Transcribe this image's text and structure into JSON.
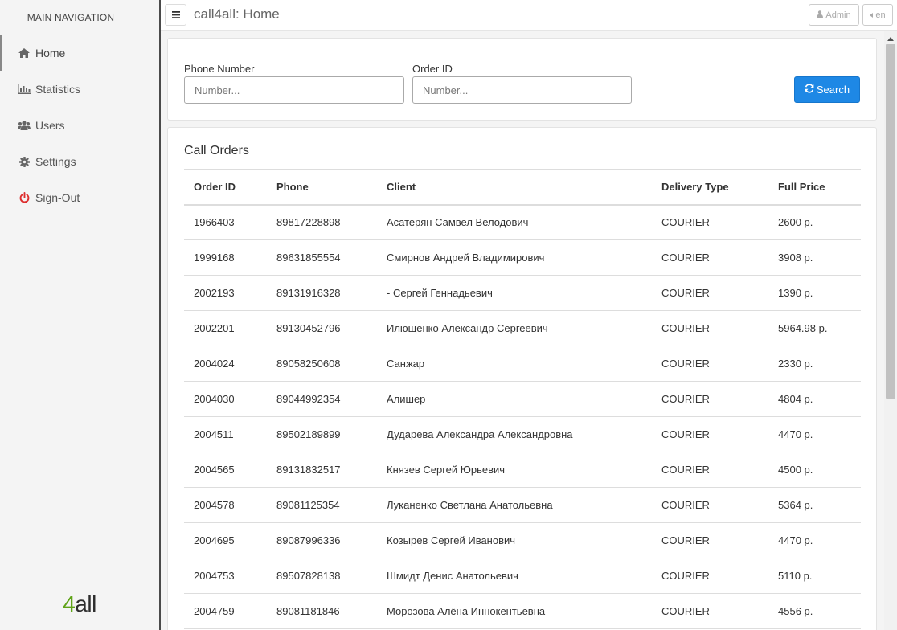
{
  "sidebar": {
    "title": "MAIN NAVIGATION",
    "items": [
      {
        "label": "Home",
        "icon": "home-icon"
      },
      {
        "label": "Statistics",
        "icon": "bar-chart-icon"
      },
      {
        "label": "Users",
        "icon": "users-icon"
      },
      {
        "label": "Settings",
        "icon": "gear-icon"
      },
      {
        "label": "Sign-Out",
        "icon": "power-icon"
      }
    ],
    "logo_part1": "4",
    "logo_part2": "all"
  },
  "header": {
    "title": "call4all: Home",
    "admin_label": "Admin",
    "lang_label": "en"
  },
  "search": {
    "phone_label": "Phone Number",
    "phone_placeholder": "Number...",
    "order_label": "Order ID",
    "order_placeholder": "Number...",
    "button_label": "Search"
  },
  "orders": {
    "title": "Call Orders",
    "columns": [
      "Order ID",
      "Phone",
      "Client",
      "Delivery Type",
      "Full Price"
    ],
    "rows": [
      [
        "1966403",
        "89817228898",
        "Асатерян Самвел Велодович",
        "COURIER",
        "2600 р."
      ],
      [
        "1999168",
        "89631855554",
        "Смирнов Андрей Владимирович",
        "COURIER",
        "3908 р."
      ],
      [
        "2002193",
        "89131916328",
        "- Сергей Геннадьевич",
        "COURIER",
        "1390 р."
      ],
      [
        "2002201",
        "89130452796",
        "Илющенко Александр Сергеевич",
        "COURIER",
        "5964.98 р."
      ],
      [
        "2004024",
        "89058250608",
        "Санжар",
        "COURIER",
        "2330 р."
      ],
      [
        "2004030",
        "89044992354",
        "Алишер",
        "COURIER",
        "4804 р."
      ],
      [
        "2004511",
        "89502189899",
        "Дударева Александра Александровна",
        "COURIER",
        "4470 р."
      ],
      [
        "2004565",
        "89131832517",
        "Князев Сергей Юрьевич",
        "COURIER",
        "4500 р."
      ],
      [
        "2004578",
        "89081125354",
        "Луканенко Светлана Анатольевна",
        "COURIER",
        "5364 р."
      ],
      [
        "2004695",
        "89087996336",
        "Козырев Сергей Иванович",
        "COURIER",
        "4470 р."
      ],
      [
        "2004753",
        "89507828138",
        "Шмидт Денис Анатольевич",
        "COURIER",
        "5110 р."
      ],
      [
        "2004759",
        "89081181846",
        "Морозова Алёна Иннокентьевна",
        "COURIER",
        "4556 р."
      ]
    ]
  },
  "colors": {
    "primary": "#1e88e5",
    "logo_green": "#5fa318",
    "signout_red": "#dd2e2e"
  }
}
